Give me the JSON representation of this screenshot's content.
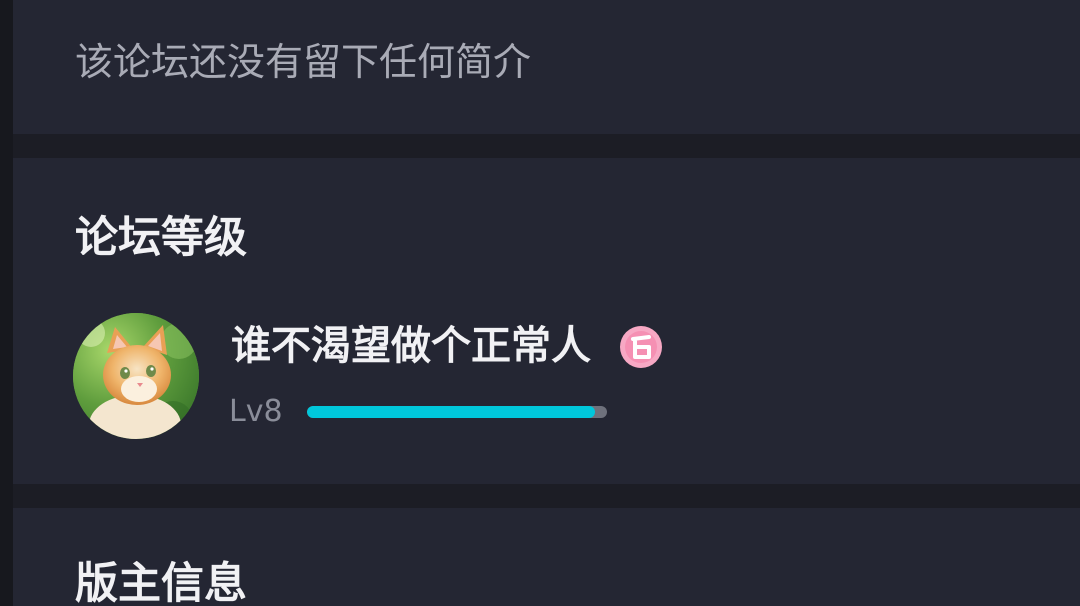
{
  "forum": {
    "intro_text": "该论坛还没有留下任何简介"
  },
  "level_section": {
    "title": "论坛等级",
    "user": {
      "name": "谁不渴望做个正常人",
      "avatar_icon": "cat-avatar",
      "badge_icon": "pink-level-badge-icon",
      "level_label": "Lv8",
      "progress_fraction": 0.96
    }
  },
  "moderator_section": {
    "title": "版主信息"
  },
  "colors": {
    "background": "#1c1d25",
    "card": "#242633",
    "progress_fill": "#00c7db",
    "progress_track": "#6e717c",
    "badge": "#f7a8c4"
  }
}
